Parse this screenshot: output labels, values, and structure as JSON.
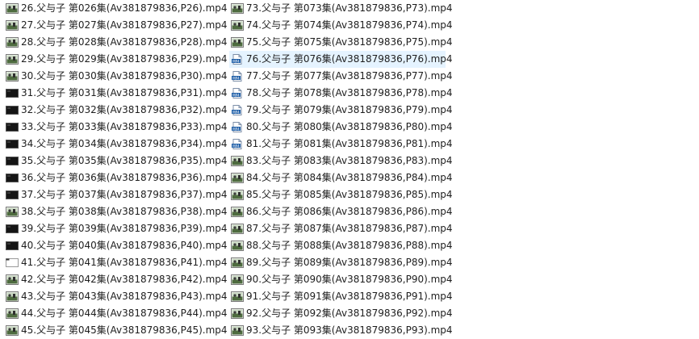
{
  "file_list": {
    "columns": [
      [
        {
          "name": "26.父与子 第026集(Av381879836,P26).mp4",
          "icon": "video-thumbnail-icon"
        },
        {
          "name": "27.父与子 第027集(Av381879836,P27).mp4",
          "icon": "video-thumbnail-icon"
        },
        {
          "name": "28.父与子 第028集(Av381879836,P28).mp4",
          "icon": "video-thumbnail-icon"
        },
        {
          "name": "29.父与子 第029集(Av381879836,P29).mp4",
          "icon": "video-thumbnail-icon"
        },
        {
          "name": "30.父与子 第030集(Av381879836,P30).mp4",
          "icon": "video-thumbnail-icon"
        },
        {
          "name": "31.父与子 第031集(Av381879836,P31).mp4",
          "icon": "video-dark-thumbnail-icon"
        },
        {
          "name": "32.父与子 第032集(Av381879836,P32).mp4",
          "icon": "video-dark-thumbnail-icon"
        },
        {
          "name": "33.父与子 第033集(Av381879836,P33).mp4",
          "icon": "video-dark-thumbnail-icon"
        },
        {
          "name": "34.父与子 第034集(Av381879836,P34).mp4",
          "icon": "video-dark-thumbnail-icon"
        },
        {
          "name": "35.父与子 第035集(Av381879836,P35).mp4",
          "icon": "video-dark-thumbnail-icon"
        },
        {
          "name": "36.父与子 第036集(Av381879836,P36).mp4",
          "icon": "video-dark-thumbnail-icon"
        },
        {
          "name": "37.父与子 第037集(Av381879836,P37).mp4",
          "icon": "video-dark-thumbnail-icon"
        },
        {
          "name": "38.父与子 第038集(Av381879836,P38).mp4",
          "icon": "video-thumbnail-icon"
        },
        {
          "name": "39.父与子 第039集(Av381879836,P39).mp4",
          "icon": "video-dark-thumbnail-icon"
        },
        {
          "name": "40.父与子 第040集(Av381879836,P40).mp4",
          "icon": "video-dark-thumbnail-icon"
        },
        {
          "name": "41.父与子 第041集(Av381879836,P41).mp4",
          "icon": "blank-thumbnail-icon"
        },
        {
          "name": "42.父与子 第042集(Av381879836,P42).mp4",
          "icon": "video-thumbnail-icon"
        },
        {
          "name": "43.父与子 第043集(Av381879836,P43).mp4",
          "icon": "video-thumbnail-icon"
        },
        {
          "name": "44.父与子 第044集(Av381879836,P44).mp4",
          "icon": "video-thumbnail-icon"
        },
        {
          "name": "45.父与子 第045集(Av381879836,P45).mp4",
          "icon": "video-thumbnail-icon"
        }
      ],
      [
        {
          "name": "73.父与子 第073集(Av381879836,P73).mp4",
          "icon": "video-thumbnail-icon"
        },
        {
          "name": "74.父与子 第074集(Av381879836,P74).mp4",
          "icon": "video-thumbnail-icon"
        },
        {
          "name": "75.父与子 第075集(Av381879836,P75).mp4",
          "icon": "video-thumbnail-icon"
        },
        {
          "name": "76.父与子 第076集(Av381879836,P76).mp4",
          "icon": "mp4-file-icon",
          "selected": true
        },
        {
          "name": "77.父与子 第077集(Av381879836,P77).mp4",
          "icon": "mp4-file-icon"
        },
        {
          "name": "78.父与子 第078集(Av381879836,P78).mp4",
          "icon": "mp4-file-icon"
        },
        {
          "name": "79.父与子 第079集(Av381879836,P79).mp4",
          "icon": "mp4-file-icon"
        },
        {
          "name": "80.父与子 第080集(Av381879836,P80).mp4",
          "icon": "mp4-file-icon"
        },
        {
          "name": "81.父与子 第081集(Av381879836,P81).mp4",
          "icon": "mp4-file-icon"
        },
        {
          "name": "83.父与子 第083集(Av381879836,P83).mp4",
          "icon": "video-thumbnail-icon"
        },
        {
          "name": "84.父与子 第084集(Av381879836,P84).mp4",
          "icon": "video-thumbnail-icon"
        },
        {
          "name": "85.父与子 第085集(Av381879836,P85).mp4",
          "icon": "video-thumbnail-icon"
        },
        {
          "name": "86.父与子 第086集(Av381879836,P86).mp4",
          "icon": "video-thumbnail-icon"
        },
        {
          "name": "87.父与子 第087集(Av381879836,P87).mp4",
          "icon": "video-thumbnail-icon"
        },
        {
          "name": "88.父与子 第088集(Av381879836,P88).mp4",
          "icon": "video-thumbnail-icon"
        },
        {
          "name": "89.父与子 第089集(Av381879836,P89).mp4",
          "icon": "video-thumbnail-icon"
        },
        {
          "name": "90.父与子 第090集(Av381879836,P90).mp4",
          "icon": "video-thumbnail-icon"
        },
        {
          "name": "91.父与子 第091集(Av381879836,P91).mp4",
          "icon": "video-thumbnail-icon"
        },
        {
          "name": "92.父与子 第092集(Av381879836,P92).mp4",
          "icon": "video-thumbnail-icon"
        },
        {
          "name": "93.父与子 第093集(Av381879836,P93).mp4",
          "icon": "video-thumbnail-icon"
        }
      ]
    ]
  },
  "colors": {
    "selection": "#e5f3ff",
    "text": "#1e1e1e",
    "file_icon_blue": "#1f5fa8"
  }
}
